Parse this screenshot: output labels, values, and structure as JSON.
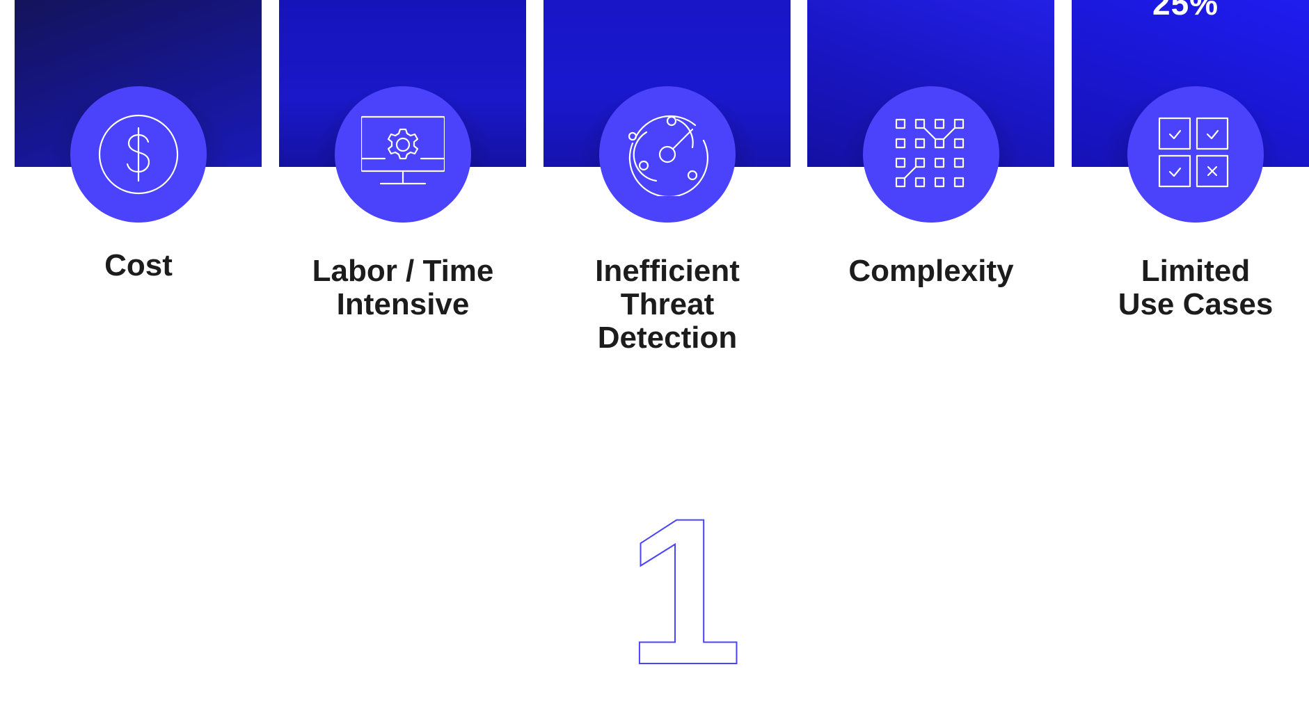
{
  "colors": {
    "accent": "#4a43fb",
    "label_text": "#1c1c1c",
    "card_blue": "#1a18c8",
    "card_dark": "#12124f"
  },
  "stat": {
    "value": "25%"
  },
  "items": [
    {
      "label": "Cost",
      "icon": "dollar-icon"
    },
    {
      "label": "Labor / Time\nIntensive",
      "icon": "monitor-gear-icon"
    },
    {
      "label": "Inefficient\nThreat\nDetection",
      "icon": "radar-icon"
    },
    {
      "label": "Complexity",
      "icon": "grid-network-icon"
    },
    {
      "label": "Limited\nUse Cases",
      "icon": "checklist-grid-icon"
    }
  ],
  "step_number": "1"
}
